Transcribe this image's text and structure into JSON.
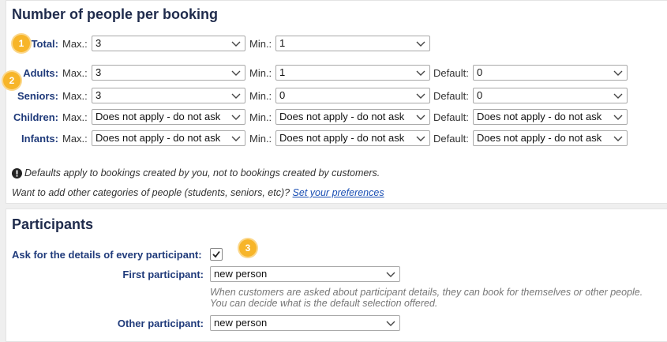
{
  "section1": {
    "title": "Number of people per booking",
    "rows": [
      {
        "label": "Total:",
        "max_label": "Max.:",
        "max": "3",
        "min_label": "Min.:",
        "min": "1"
      },
      {
        "label": "Adults:",
        "max_label": "Max.:",
        "max": "3",
        "min_label": "Min.:",
        "min": "1",
        "default_label": "Default:",
        "default": "0"
      },
      {
        "label": "Seniors:",
        "max_label": "Max.:",
        "max": "3",
        "min_label": "Min.:",
        "min": "0",
        "default_label": "Default:",
        "default": "0"
      },
      {
        "label": "Children:",
        "max_label": "Max.:",
        "max": "Does not apply - do not ask",
        "min_label": "Min.:",
        "min": "Does not apply - do not ask",
        "default_label": "Default:",
        "default": "Does not apply - do not ask"
      },
      {
        "label": "Infants:",
        "max_label": "Max.:",
        "max": "Does not apply - do not ask",
        "min_label": "Min.:",
        "min": "Does not apply - do not ask",
        "default_label": "Default:",
        "default": "Does not apply - do not ask"
      }
    ],
    "note": "Defaults apply to bookings created by you, not to bookings created by customers.",
    "pref_text": "Want to add other categories of people (students, seniors, etc)?",
    "pref_link": "Set your preferences"
  },
  "section2": {
    "title": "Participants",
    "ask_label": "Ask for the details of every participant:",
    "ask_checked": true,
    "first_label": "First participant:",
    "first_value": "new person",
    "help_line1": "When customers are asked about participant details, they can book for themselves or other people.",
    "help_line2": "You can decide what is the default selection offered.",
    "other_label": "Other participant:",
    "other_value": "new person"
  },
  "badges": [
    "1",
    "2",
    "3"
  ],
  "colors": {
    "badge": "#f7b529",
    "label": "#1f3a7a",
    "link": "#1a4fb4"
  }
}
